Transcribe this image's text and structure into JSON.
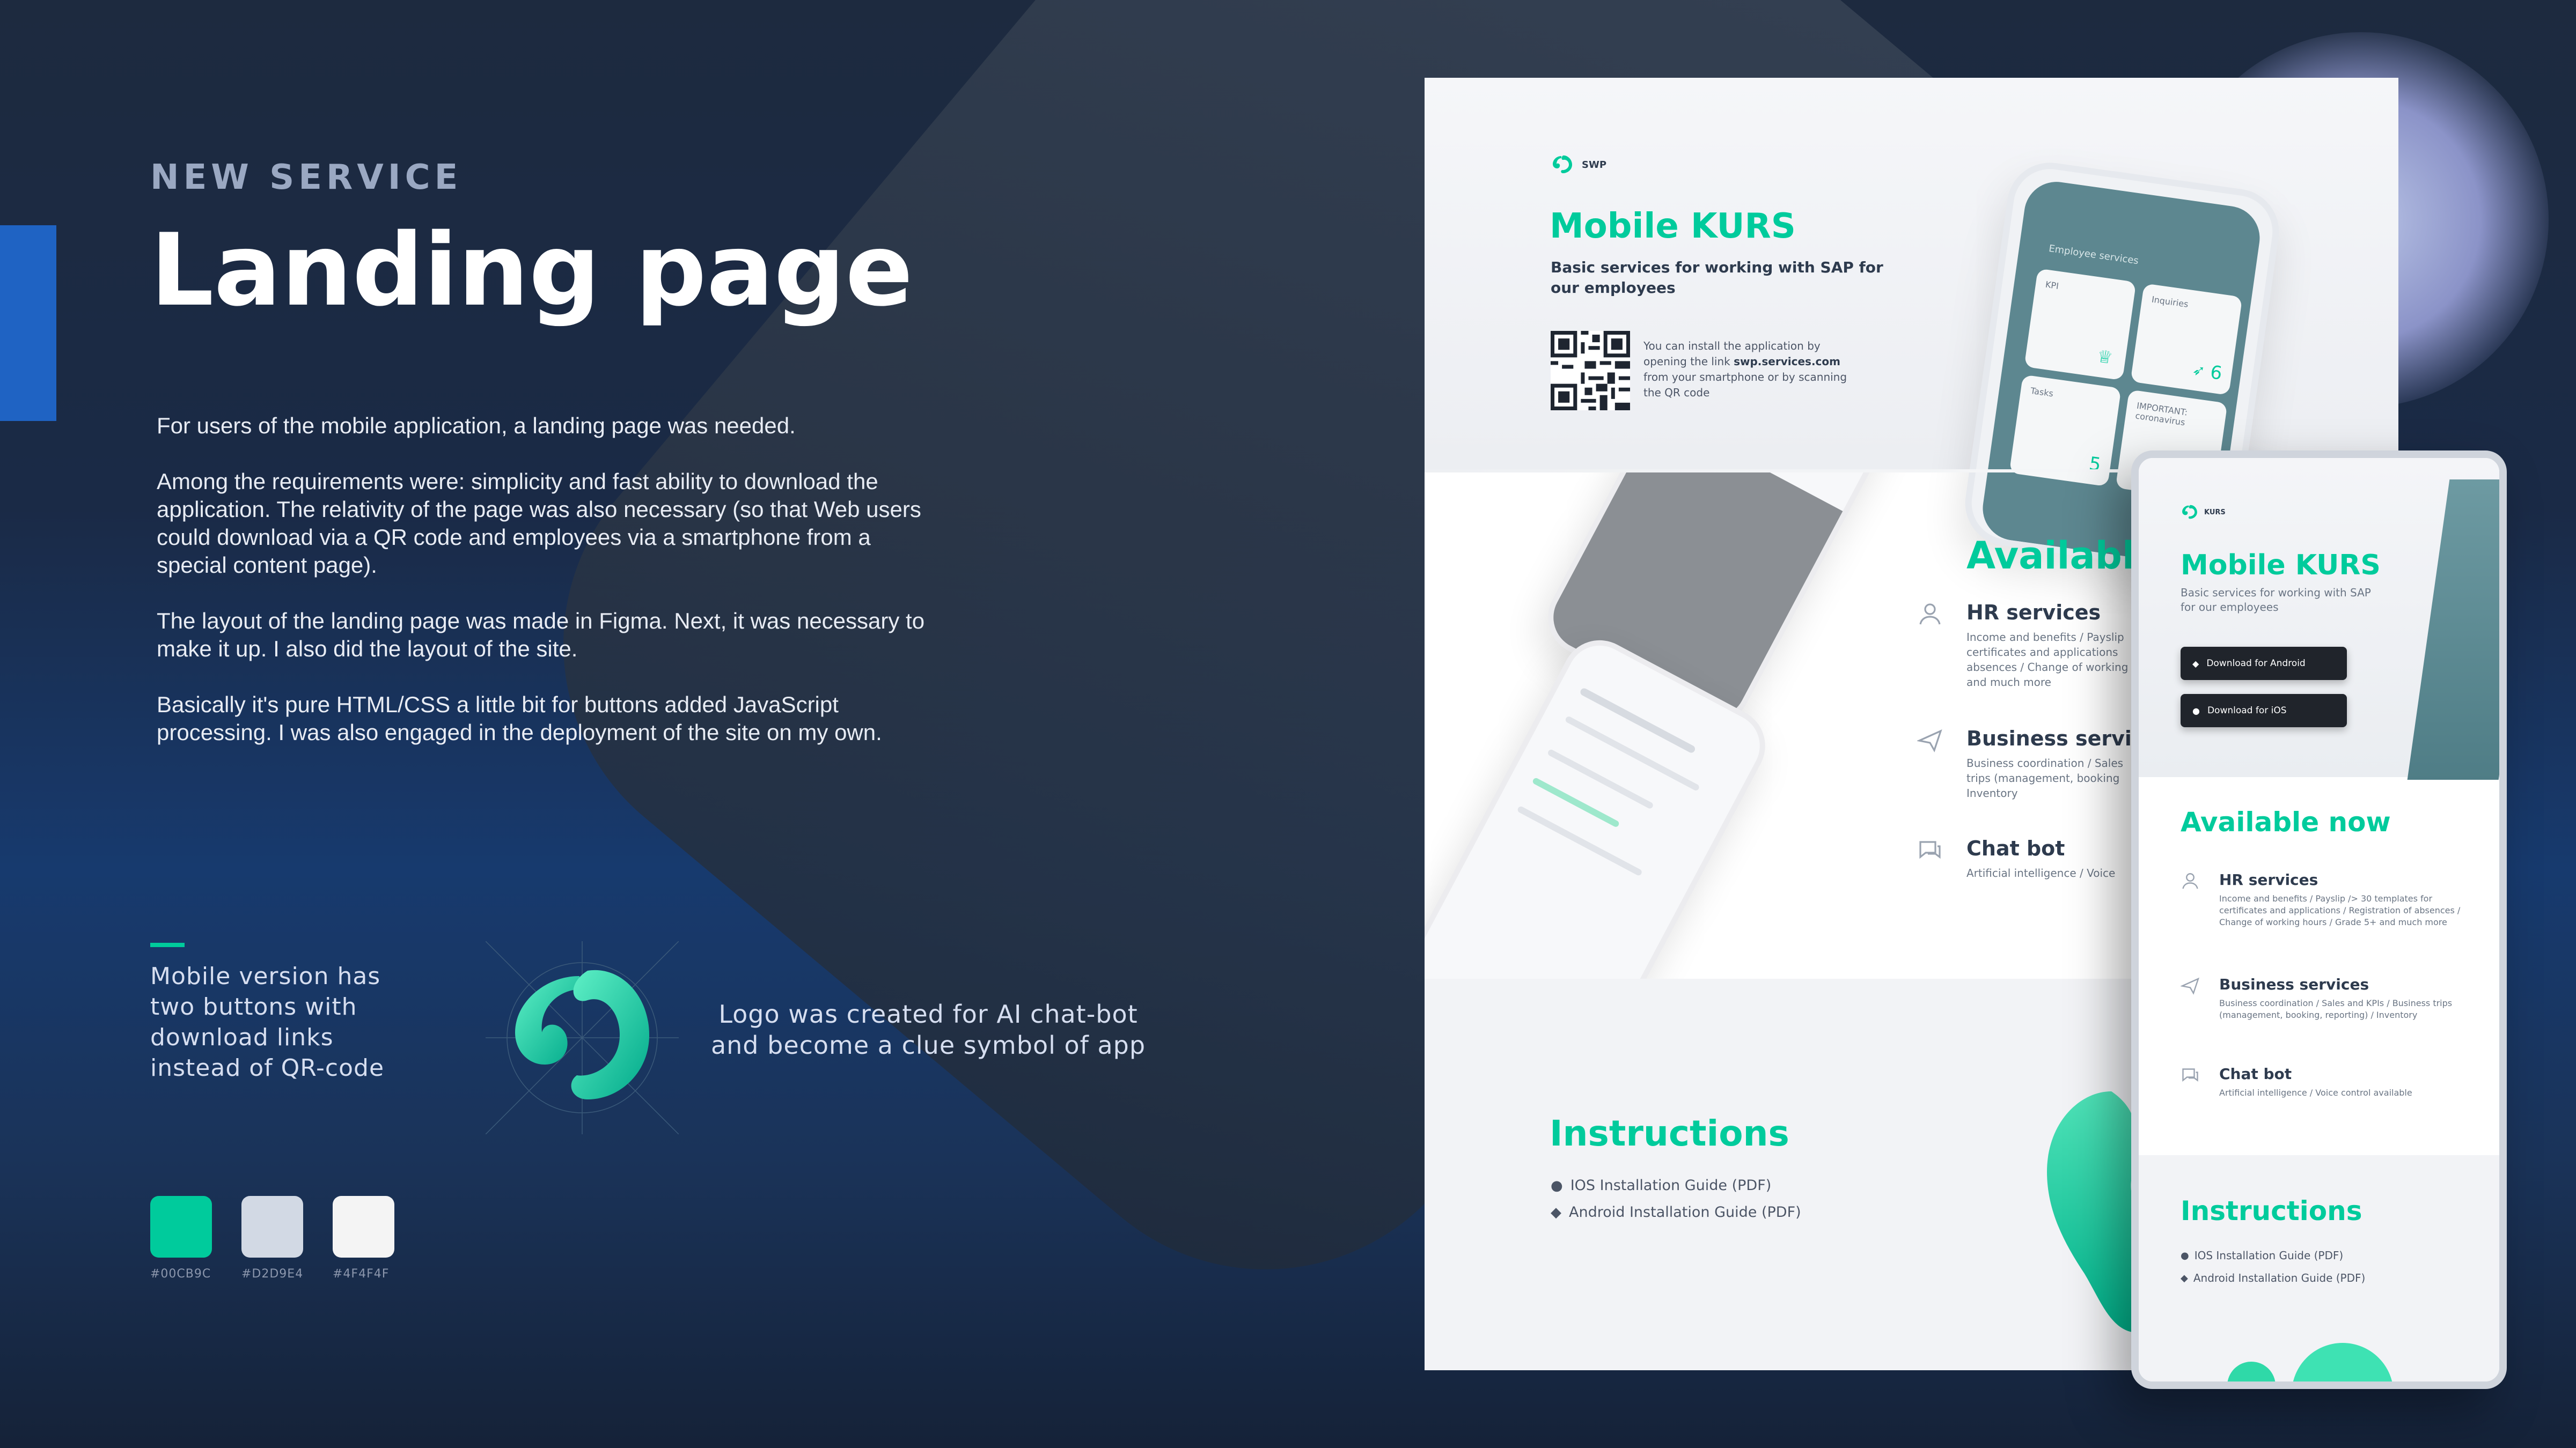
{
  "header": {
    "eyebrow": "NEW SERVICE",
    "title": "Landing page"
  },
  "description": {
    "paragraphs": [
      "For users of the mobile application, a landing page was needed.",
      "Among the requirements were: simplicity and fast ability to download the application. The relativity of the page was also necessary (so that Web users could download via a QR code and employees via a smartphone from a special content page).",
      "The layout of the landing page was made in Figma. Next, it was necessary to make it up. I also did the layout of the site.",
      "Basically it's pure HTML/CSS a little bit for buttons added JavaScript processing.  I was also engaged in the deployment of the site on my own."
    ]
  },
  "notes": {
    "mobile": "Mobile version has two buttons with download links instead of QR-code",
    "logo": "Logo was created for AI chat-bot and become a clue symbol of app"
  },
  "palette": [
    {
      "color": "#00CB9C",
      "label": "#00CB9C"
    },
    {
      "color": "#D2D9E4",
      "label": "#D2D9E4"
    },
    {
      "color": "#F4F4F4",
      "label": "#4F4F4F"
    }
  ],
  "desktop": {
    "logo_text": "SWP",
    "title": "Mobile KURS",
    "subtitle": "Basic services for working with SAP for our employees",
    "qr_text_pre": "You can install the application by opening the link ",
    "qr_link": "swp.services.com",
    "qr_text_post": " from your smartphone or by scanning the QR code",
    "phone": {
      "header": "Employee services",
      "tiles": [
        "KPI",
        "Inquiries",
        "Tasks",
        "IMPORTANT: coronavirus"
      ],
      "counts": [
        "6",
        "5"
      ]
    },
    "available_title": "Available",
    "services": [
      {
        "icon": "user-icon",
        "title": "HR services",
        "desc": "Income and benefits / Payslip certificates and applications absences / Change of working and much more"
      },
      {
        "icon": "plane-icon",
        "title": "Business services",
        "desc": "Business coordination / Sales trips (management, booking Inventory"
      },
      {
        "icon": "chat-icon",
        "title": "Chat bot",
        "desc": "Artificial intelligence / Voice"
      }
    ],
    "instructions_title": "Instructions",
    "links": [
      "IOS Installation Guide (PDF)",
      "Android Installation Guide (PDF)"
    ]
  },
  "mobile": {
    "logo_text": "KURS",
    "title": "Mobile KURS",
    "subtitle": "Basic services for working with SAP for our employees",
    "buttons": [
      "Download for Android",
      "Download for iOS"
    ],
    "available_title": "Available now",
    "services": [
      {
        "icon": "user-icon",
        "title": "HR services",
        "desc": "Income and benefits / Payslip /> 30 templates for certificates and applications / Registration of absences / Change of working hours / Grade 5+ and much more"
      },
      {
        "icon": "plane-icon",
        "title": "Business services",
        "desc": "Business coordination / Sales and KPIs / Business trips (management, booking, reporting) / Inventory"
      },
      {
        "icon": "chat-icon",
        "title": "Chat bot",
        "desc": "Artificial intelligence / Voice control available"
      }
    ],
    "instructions_title": "Instructions",
    "links": [
      "IOS Installation Guide (PDF)",
      "Android Installation Guide (PDF)"
    ]
  },
  "colors": {
    "accent": "#00CB9C",
    "accent_bar": "#1F63C3",
    "text_dark": "#2E3B4E"
  }
}
